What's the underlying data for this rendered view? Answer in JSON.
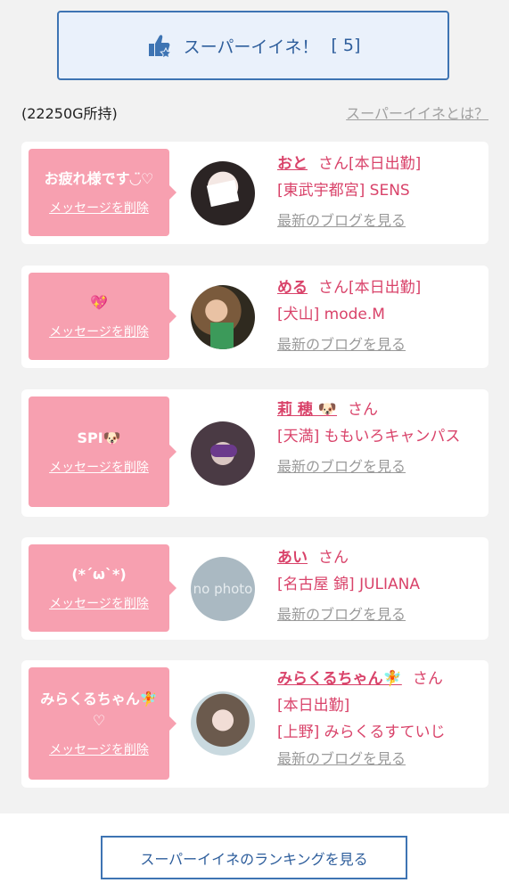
{
  "super_button": {
    "label": "スーパーイイネ！",
    "count": "[ 5]"
  },
  "holding": "(22250G所持)",
  "about_link": "スーパーイイネとは？",
  "delete_label": "メッセージを削除",
  "blog_label": "最新のブログを見る",
  "san_label": "さん",
  "cards": [
    {
      "message": "お疲れ様です◡̈♡",
      "name": "おと",
      "lines": [
        "さん[本日出勤]",
        "[東武宇都宮] SENS"
      ]
    },
    {
      "message": "💖",
      "name": "める",
      "lines": [
        "さん[本日出勤]",
        "[犬山] mode.M"
      ]
    },
    {
      "message": "SPI🐶",
      "name": "莉 穂 🐶",
      "lines": [
        "さん",
        "[天満] ももいろキャンパス"
      ]
    },
    {
      "message": "(*´ω`*)",
      "name": "あい",
      "lines": [
        "さん",
        "[名古屋 錦] JULIANA"
      ]
    },
    {
      "message": "みらくるちゃん🧚 ♡",
      "name": "みらくるちゃん🧚",
      "lines": [
        "さん",
        "[本日出勤]",
        "[上野] みらくるすていじ"
      ]
    }
  ],
  "no_photo_text": "no photo",
  "ranking_button": "スーパーイイネのランキングを見る",
  "colors": {
    "accent_blue": "#3e74b3",
    "pink": "#f7a0b0",
    "name_pink": "#d9436a"
  }
}
